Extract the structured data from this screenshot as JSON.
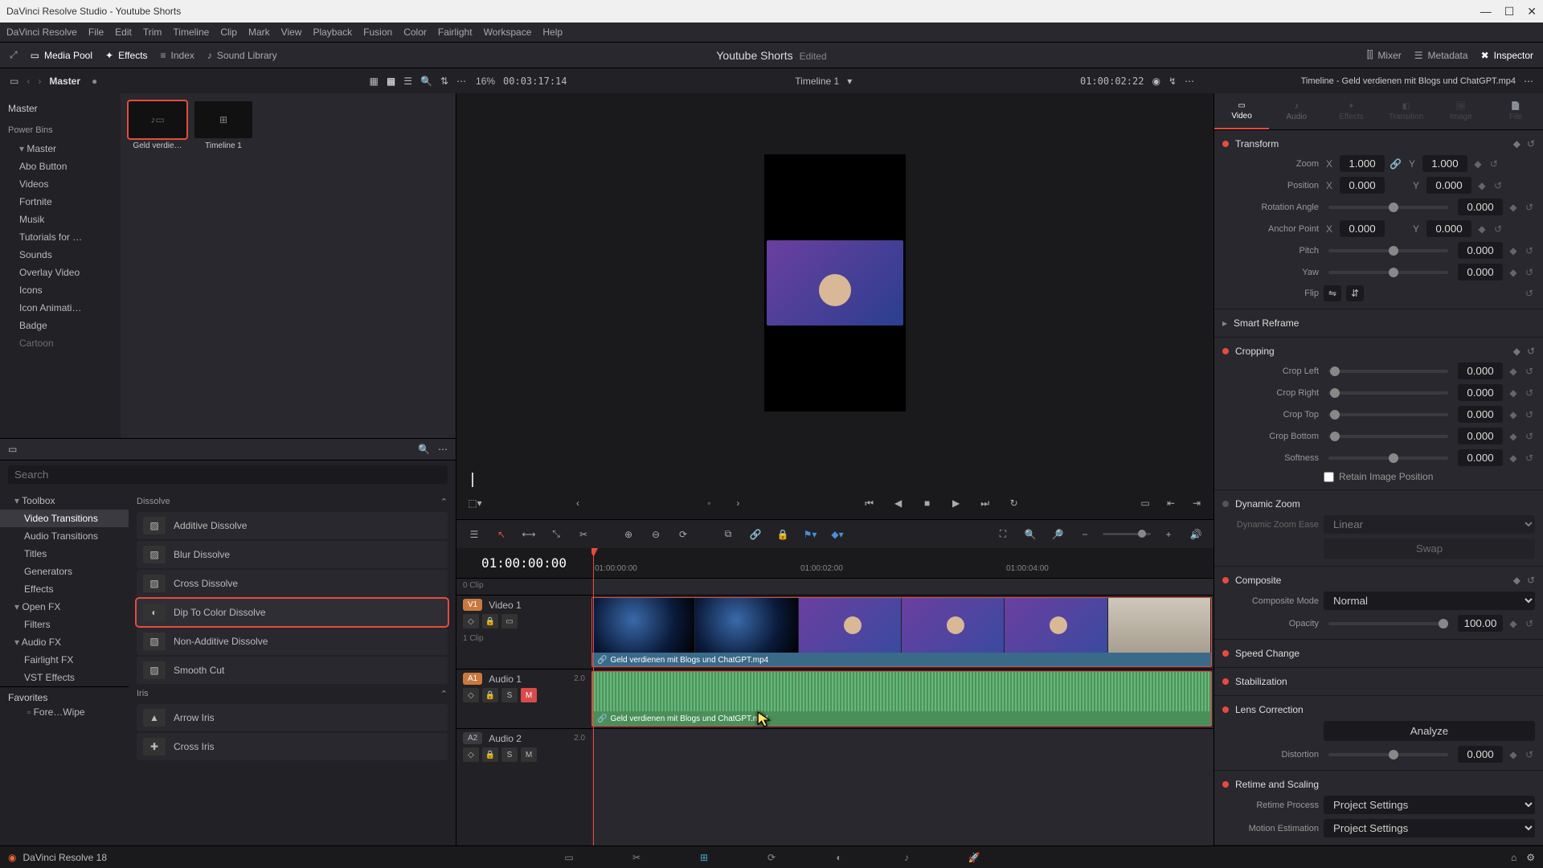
{
  "window": {
    "title": "DaVinci Resolve Studio - Youtube Shorts"
  },
  "menu": [
    "DaVinci Resolve",
    "File",
    "Edit",
    "Trim",
    "Timeline",
    "Clip",
    "Mark",
    "View",
    "Playback",
    "Fusion",
    "Color",
    "Fairlight",
    "Workspace",
    "Help"
  ],
  "topbar": {
    "media_pool": "Media Pool",
    "effects": "Effects",
    "index": "Index",
    "sound_library": "Sound Library",
    "project": "Youtube Shorts",
    "edited": "Edited",
    "mixer": "Mixer",
    "metadata": "Metadata",
    "inspector": "Inspector"
  },
  "toolbar2": {
    "bin": "Master",
    "zoom_pct": "16%",
    "source_tc": "00:03:17:14",
    "timeline_name": "Timeline 1",
    "timeline_tc": "01:00:02:22"
  },
  "media_tree": {
    "root": "Master",
    "power_bins": "Power Bins",
    "master_expand": "Master",
    "items": [
      "Abo Button",
      "Videos",
      "Fortnite",
      "Musik",
      "Tutorials for …",
      "Sounds",
      "Overlay Video",
      "Icons",
      "Icon Animati…",
      "Badge",
      "Cartoon"
    ]
  },
  "clips": [
    {
      "name": "Geld verdie…",
      "type": "video",
      "selected": true
    },
    {
      "name": "Timeline 1",
      "type": "timeline",
      "selected": false
    }
  ],
  "effects_panel": {
    "search_placeholder": "Search",
    "toolbox": "Toolbox",
    "tree": [
      {
        "label": "Video Transitions",
        "selected": true
      },
      {
        "label": "Audio Transitions"
      },
      {
        "label": "Titles"
      },
      {
        "label": "Generators"
      },
      {
        "label": "Effects"
      }
    ],
    "openfx": "Open FX",
    "openfx_children": [
      "Filters"
    ],
    "audiofx": "Audio FX",
    "audiofx_children": [
      "Fairlight FX",
      "VST Effects"
    ],
    "section_dissolve": "Dissolve",
    "dissolve_items": [
      "Additive Dissolve",
      "Blur Dissolve",
      "Cross Dissolve",
      "Dip To Color Dissolve",
      "Non-Additive Dissolve",
      "Smooth Cut"
    ],
    "dissolve_selected": 3,
    "section_iris": "Iris",
    "iris_items": [
      "Arrow Iris",
      "Cross Iris"
    ],
    "favorites": "Favorites",
    "favorite_item": "Fore…Wipe"
  },
  "viewer": {
    "ruler_ticks": [
      "01:00:00:00",
      "01:00:02:00",
      "01:00:04:00"
    ]
  },
  "timeline": {
    "master_tc": "01:00:00:00",
    "clip_count": "0 Clip",
    "clip_count2": "1 Clip",
    "video_track": {
      "badge": "V1",
      "name": "Video 1"
    },
    "audio1": {
      "badge": "A1",
      "name": "Audio 1",
      "ch": "2.0"
    },
    "audio2": {
      "badge": "A2",
      "name": "Audio 2",
      "ch": "2.0"
    },
    "clip_name": "Geld verdienen mit Blogs und ChatGPT.mp4"
  },
  "inspector": {
    "header": "Timeline - Geld verdienen mit Blogs und ChatGPT.mp4",
    "tabs": [
      "Video",
      "Audio",
      "Effects",
      "Transition",
      "Image",
      "File"
    ],
    "active_tab": 0,
    "transform": {
      "title": "Transform",
      "zoom": "Zoom",
      "zoom_x": "1.000",
      "zoom_y": "1.000",
      "position": "Position",
      "pos_x": "0.000",
      "pos_y": "0.000",
      "rotation": "Rotation Angle",
      "rotation_v": "0.000",
      "anchor": "Anchor Point",
      "anchor_x": "0.000",
      "anchor_y": "0.000",
      "pitch": "Pitch",
      "pitch_v": "0.000",
      "yaw": "Yaw",
      "yaw_v": "0.000",
      "flip": "Flip"
    },
    "smart_reframe": "Smart Reframe",
    "cropping": {
      "title": "Cropping",
      "left": "Crop Left",
      "left_v": "0.000",
      "right": "Crop Right",
      "right_v": "0.000",
      "top": "Crop Top",
      "top_v": "0.000",
      "bottom": "Crop Bottom",
      "bottom_v": "0.000",
      "softness": "Softness",
      "softness_v": "0.000",
      "retain": "Retain Image Position"
    },
    "dynamic_zoom": {
      "title": "Dynamic Zoom",
      "ease_label": "Dynamic Zoom Ease",
      "ease": "Linear",
      "swap": "Swap"
    },
    "composite": {
      "title": "Composite",
      "mode_label": "Composite Mode",
      "mode": "Normal",
      "opacity_label": "Opacity",
      "opacity": "100.00"
    },
    "speed_change": "Speed Change",
    "stabilization": "Stabilization",
    "lens": {
      "title": "Lens Correction",
      "analyze": "Analyze",
      "distortion": "Distortion",
      "distortion_v": "0.000"
    },
    "retime": {
      "title": "Retime and Scaling",
      "process": "Retime Process",
      "process_v": "Project Settings",
      "motion": "Motion Estimation",
      "motion_v": "Project Settings"
    }
  },
  "bottombar": {
    "version": "DaVinci Resolve 18"
  }
}
